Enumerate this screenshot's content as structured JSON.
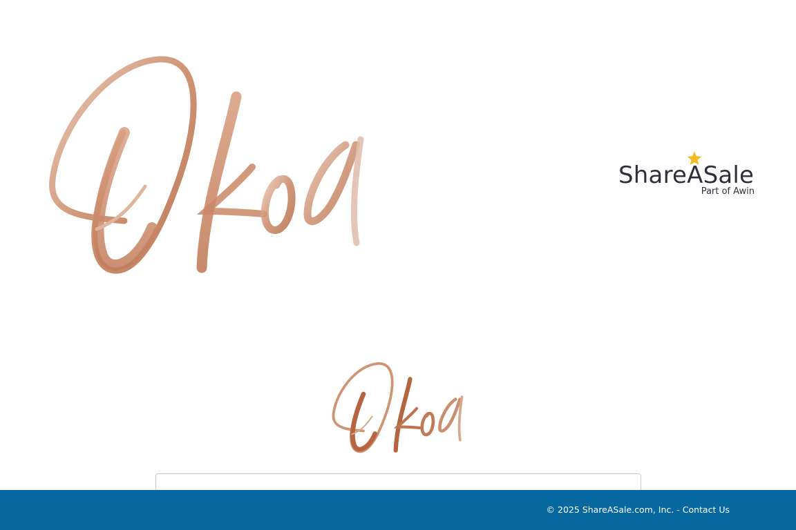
{
  "brand": {
    "merchant_logo_text": "Okoa",
    "merchant_logo_color": "#c27d5c"
  },
  "network_logo": {
    "wordmark": "ShareASale",
    "tagline": "Part of Awin",
    "star_color": "#f5b922",
    "text_color": "#2f2f3a"
  },
  "footer": {
    "copyright": "© 2025 ShareASale.com, Inc. -",
    "contact_link": "Contact Us",
    "background_color": "#07679f"
  }
}
